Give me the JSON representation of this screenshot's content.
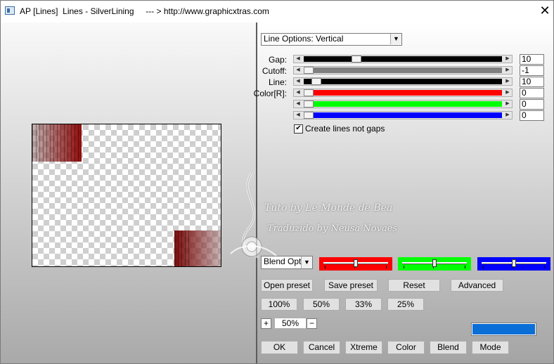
{
  "window": {
    "title": "AP [Lines]  Lines - SilverLining     --- > http://www.graphicxtras.com",
    "close_glyph": "✕"
  },
  "line_options": {
    "selected": "Line Options: Vertical"
  },
  "sliders": [
    {
      "label": "Gap:",
      "value": "10",
      "fill_color": "#000000",
      "level": 0.25
    },
    {
      "label": "Cutoff:",
      "value": "-1",
      "fill_color": "#7f7f7f",
      "level": 0.0
    },
    {
      "label": "Line:",
      "value": "10",
      "fill_color": "#000000",
      "level": 0.04
    },
    {
      "label": "Color[R]:",
      "value": "0",
      "fill_color": "#ff0000",
      "level": 0.0
    },
    {
      "label": "",
      "value": "0",
      "fill_color": "#00ff00",
      "level": 0.0
    },
    {
      "label": "",
      "value": "0",
      "fill_color": "#0000ff",
      "level": 0.0
    }
  ],
  "create_lines": {
    "label": "Create lines not gaps",
    "checked": true,
    "mark": "✔"
  },
  "blend": {
    "selected": "Blend Optio",
    "channels": [
      {
        "color": "#ff0000",
        "level": 0.5
      },
      {
        "color": "#00ff00",
        "level": 0.5
      },
      {
        "color": "#0000ff",
        "level": 0.5
      }
    ]
  },
  "buttons": {
    "open_preset": "Open preset",
    "save_preset": "Save preset",
    "reset": "Reset",
    "advanced": "Advanced",
    "zoom_100": "100%",
    "zoom_50": "50%",
    "zoom_33": "33%",
    "zoom_25": "25%",
    "ok": "OK",
    "cancel": "Cancel",
    "xtreme": "Xtreme",
    "color": "Color",
    "blend": "Blend",
    "mode": "Mode"
  },
  "zoom": {
    "plus": "+",
    "value": "50%",
    "minus": "−"
  },
  "accent_swatch": "#0a6ed7",
  "watermark": {
    "line1": "Tuto by Le Monde de Bea",
    "line2": "Traduzido by Neusa Novaes"
  }
}
